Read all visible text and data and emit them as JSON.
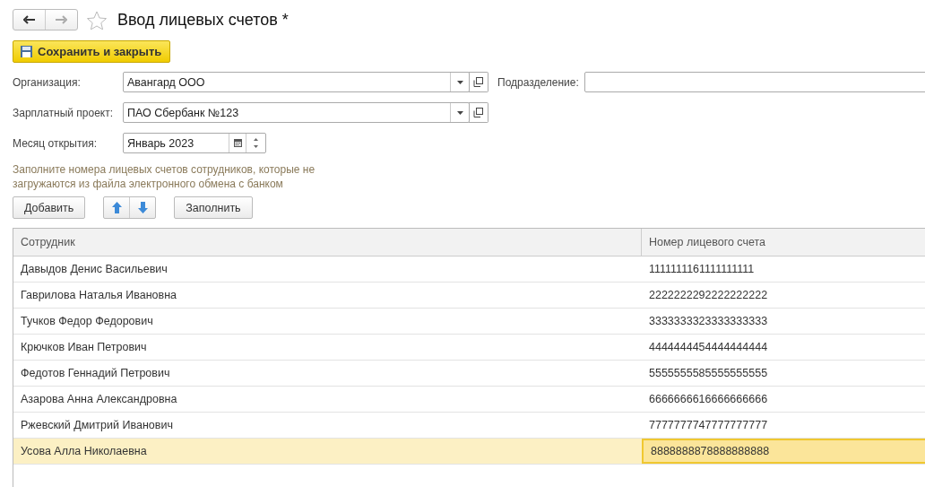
{
  "window": {
    "title": "Ввод лицевых счетов *",
    "favorite": false
  },
  "toolbar": {
    "save_button": "Сохранить и закрыть"
  },
  "fields": [
    {
      "label": "Организация:",
      "value": "Авангард ООО",
      "kind": "select"
    },
    {
      "label": "Подразделение:",
      "kind": "text"
    },
    {
      "label": "Зарплатный проект:",
      "value": "ПАО Сбербанк №123",
      "kind": "select"
    },
    {
      "label": "Месяц открытия:",
      "value": "Январь 2023",
      "kind": "month"
    }
  ],
  "hint": "Заполните номера лицевых счетов сотрудников, которые не загружаются из файла электронного обмена с банком",
  "table_buttons": {
    "add": "Добавить",
    "fill": "Заполнить"
  },
  "table": {
    "columns": [
      "Сотрудник",
      "Номер лицевого счета"
    ],
    "rows": [
      {
        "employee": "Давыдов Денис Васильевич",
        "account": "1111111161111111111",
        "selected": false
      },
      {
        "employee": "Гаврилова Наталья Ивановна",
        "account": "2222222292222222222",
        "selected": false
      },
      {
        "employee": "Тучков Федор Федорович",
        "account": "3333333323333333333",
        "selected": false
      },
      {
        "employee": "Крючков Иван Петрович",
        "account": "4444444454444444444",
        "selected": false
      },
      {
        "employee": "Федотов Геннадий Петрович",
        "account": "5555555585555555555",
        "selected": false
      },
      {
        "employee": "Азарова Анна Александровна",
        "account": "6666666616666666666",
        "selected": false
      },
      {
        "employee": "Ржевский Дмитрий Иванович",
        "account": "7777777747777777777",
        "selected": false
      },
      {
        "employee": "Усова Алла Николаевна",
        "account": "8888888878888888888",
        "selected": true
      }
    ]
  }
}
